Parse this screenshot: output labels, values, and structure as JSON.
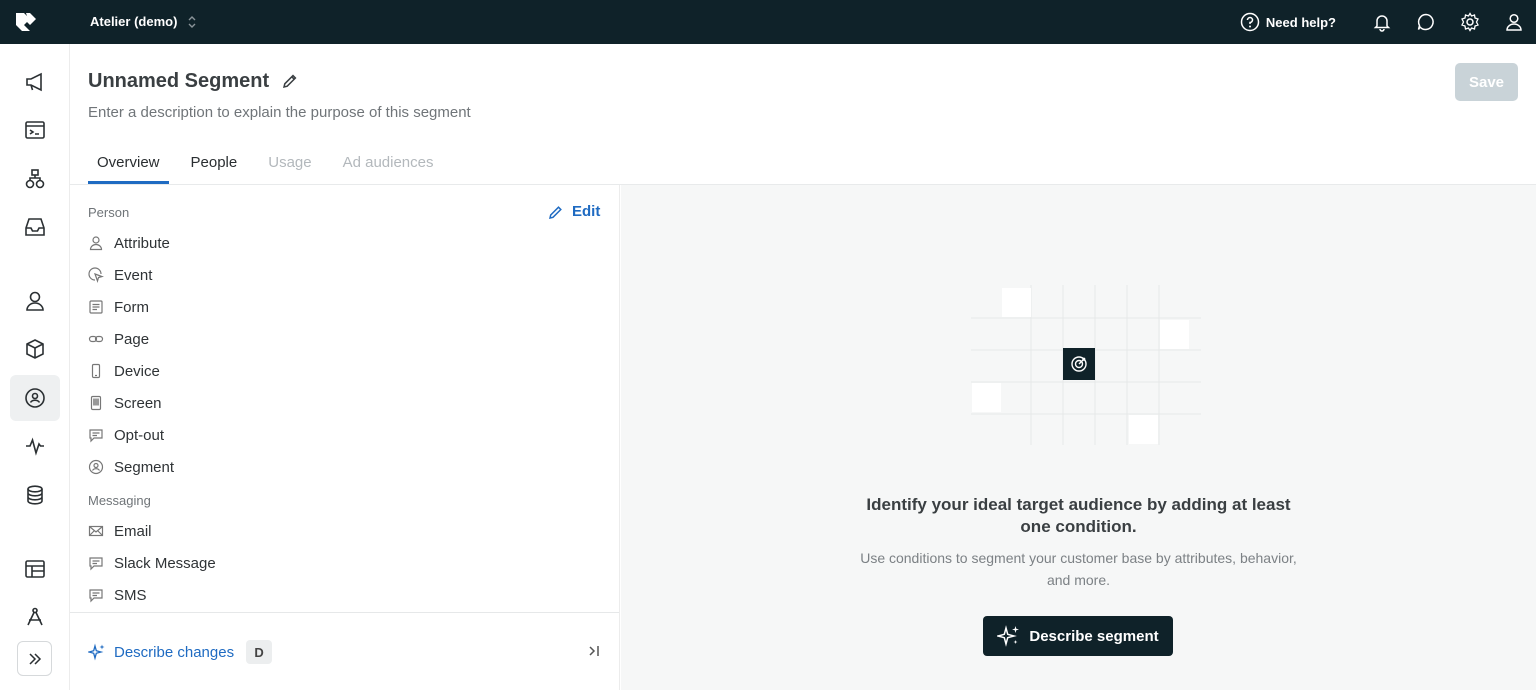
{
  "topbar": {
    "workspace": "Atelier (demo)",
    "help_label": "Need help?",
    "icons": [
      "bell-icon",
      "chat-icon",
      "gear-icon",
      "user-icon"
    ]
  },
  "nav": {
    "items": [
      "megaphone-icon",
      "terminal-icon",
      "journeys-icon",
      "inbox-icon",
      "people-icon",
      "objects-icon",
      "segments-icon",
      "activity-icon",
      "database-icon",
      "content-icon",
      "design-icon"
    ],
    "active": "segments-icon"
  },
  "header": {
    "title": "Unnamed Segment",
    "description": "Enter a description to explain the purpose of this segment",
    "save_label": "Save"
  },
  "tabs": [
    {
      "label": "Overview",
      "state": "active"
    },
    {
      "label": "People",
      "state": "normal"
    },
    {
      "label": "Usage",
      "state": "disabled"
    },
    {
      "label": "Ad audiences",
      "state": "disabled"
    }
  ],
  "panel": {
    "section_person": "Person",
    "edit_label": "Edit",
    "person_items": [
      {
        "label": "Attribute",
        "icon": "person-icon"
      },
      {
        "label": "Event",
        "icon": "cursor-icon"
      },
      {
        "label": "Form",
        "icon": "form-icon"
      },
      {
        "label": "Page",
        "icon": "link-icon"
      },
      {
        "label": "Device",
        "icon": "phone-icon"
      },
      {
        "label": "Screen",
        "icon": "screen-icon"
      },
      {
        "label": "Opt-out",
        "icon": "comment-icon"
      },
      {
        "label": "Segment",
        "icon": "segment-icon"
      }
    ],
    "section_messaging": "Messaging",
    "messaging_items": [
      {
        "label": "Email",
        "icon": "mail-icon"
      },
      {
        "label": "Slack Message",
        "icon": "comment-icon"
      },
      {
        "label": "SMS",
        "icon": "comment-icon"
      }
    ],
    "describe_label": "Describe changes",
    "describe_shortcut": "D"
  },
  "empty_state": {
    "title": "Identify your ideal target audience by adding at least one condition.",
    "subtitle": "Use conditions to segment your customer base by attributes, behavior, and more.",
    "cta_label": "Describe segment"
  },
  "colors": {
    "topbar": "#0f2229",
    "accent": "#1f6bc2",
    "save_disabled": "#c9d3d8"
  }
}
